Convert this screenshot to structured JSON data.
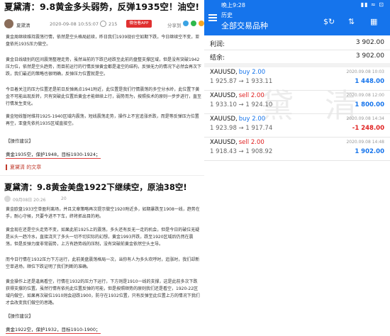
{
  "article1": {
    "title": "夏黛清：9.8黄金多头弱势，反弹1935空！油空!",
    "author": "夏黛清",
    "date": "2020-09-08 10:55:07",
    "views": "215",
    "app_button": "微信看APP",
    "share_label": "分享到",
    "paragraphs": [
      "黄金周继续维持震荡行情，依然是空头格局延续，昨日我们1939现价空如期下跌，今日继续空不变，亚盘依托1935压力做空。",
      "黄金日线级别的区间震荡整理走势，虽然当前的下跌已经跌至此前的盘整支撑区域，但是没有突破1942压力位，依然是空头趋势，而目前运行的行情反弹黄金都是逢空的结构，反弹无力的情况下必然会再次下跌，我们最近的策略也很明确，反弹压力位置就是空。",
      "今日着关注的压力位置还是前日反弹高点1941附近，此位置是我们行情震荡的多空分水岭，此位置下黄金不可能出现反转，只有突破此位置后黄金才能继续上行，弱势而为，按照技术的原则一步步进行，直至行情发生变化。",
      "黄金短线暂时维持1925-1940区域内震荡，短线震荡走势，操作上不宜追涨杀跌，而是等反弹压力位置再空，亚盘先依托1935区域直接空。"
    ],
    "advice_label": "【操作建议】",
    "plan": "黄金1935空，保护1948，目标1930-1924；",
    "more_link": "夏黛清 的文章"
  },
  "article2": {
    "title": "夏黛清：9.8黄金美盘1922下继续空，原油38空!",
    "date": "09月08日 20:26",
    "count": "20",
    "paragraphs": [
      "黄金欧盘1933空单盈利离场，并且文章策略再次提示做空1920附近多，如期暴跌至1908一线，趋势在手，耐心守候，只要今进不下车，终将抓出目的地。",
      "黄金现在还是空头走势不变，如果此前1925上的震荡，多头还有反无一走的机会，但是今日的破位无疑是从头一趋冷水，直接浇灭了多头一切不切实际的幻想，黄金1993开跌，跌至1920区域后仍然在震荡，但是反弹力度非常弱势，上方有趋势线的压制，没有突破前黄金依然空头主导。",
      "而今日行情在1932压力下方运行，此前美盘震荡格局一次，当你有人为多头欢呼时，追涨时，我们却新空单进场，顺位下跌证明了我们判断的准确。",
      "黄金操作上还是逢高看空，行情在1932的压力下运行，下方则是1910一线的支撑，这是此前多次下跌获得支撑的位置。虽然行情有依托此位置反弹的可能，但是按照顺势的原则我们还是看空，1920-22区域内做空，如果再次破位1910则会迎跌1900，防守在1932位置，只有反弹至此位置上方的情况下我们才会改变我们做空的思路。"
    ],
    "advice_label": "【操作建议】",
    "plan": "黄金1922空，保护1932，目标1910-1900；"
  },
  "phone": {
    "status_time": "晚上9:28",
    "status_icons": "▮▮ ≈ ⊡",
    "header_small": "历史",
    "header_title": "全部交易品种",
    "summary": [
      {
        "label": "利润:",
        "value": "3 902.00"
      },
      {
        "label": "结余:",
        "value": "3 902.00"
      }
    ],
    "trades": [
      {
        "symbol": "XAUUSD,",
        "direction": "buy",
        "lots": "2.00",
        "prices": "1 925.87 → 1 933.11",
        "date": "2020.09.08 10:03",
        "profit": "1 448.00",
        "profit_sign": "pos"
      },
      {
        "symbol": "XAUUSD,",
        "direction": "sell",
        "lots": "2.00",
        "prices": "1 933.10 → 1 924.10",
        "date": "2020.09.08 12:00",
        "profit": "1 800.00",
        "profit_sign": "pos"
      },
      {
        "symbol": "XAUUSD,",
        "direction": "buy",
        "lots": "2.00",
        "prices": "1 923.98 → 1 917.74",
        "date": "2020.09.08 14:34",
        "profit": "-1 248.00",
        "profit_sign": "neg"
      },
      {
        "symbol": "XAUUSD,",
        "direction": "sell",
        "lots": "2.00",
        "prices": "1 918.43 → 1 908.92",
        "date": "2020.09.08 14:48",
        "profit": "1 902.00",
        "profit_sign": "pos"
      }
    ]
  },
  "colors": {
    "brand_blue": "#1574ec",
    "sell_red": "#e02020",
    "accent_red": "#e03030"
  }
}
